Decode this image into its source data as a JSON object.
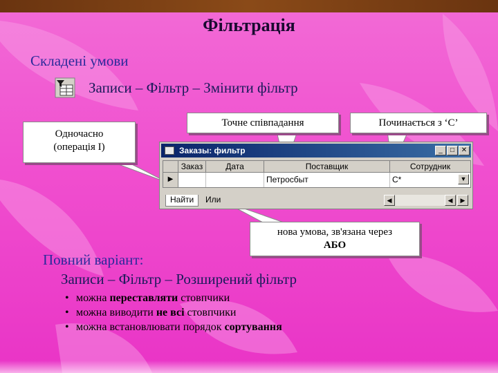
{
  "title": "Фільтрація",
  "subtitle": "Складені умови",
  "menu_path": "Записи – Фільтр – Змінити фільтр",
  "callouts": {
    "simultaneous_line1": "Одночасно",
    "simultaneous_line2": "(операція І)",
    "exact_match": "Точне співпадання",
    "starts_with": "Починається з ‘С’",
    "new_condition_line1": "нова умова, зв'язана через",
    "new_condition_line2": "АБО"
  },
  "window": {
    "title": "Заказы: фильтр",
    "columns": [
      "Заказ",
      "Дата",
      "Поставщик",
      "Сотрудник"
    ],
    "row": {
      "supplier": "Петросбыт",
      "employee": "С*"
    },
    "tabs": {
      "find": "Найти",
      "or": "Или"
    }
  },
  "full_variant": {
    "heading": "Повний варіант:",
    "path": "Записи – Фільтр – Розширений фільтр",
    "bullets": [
      {
        "pre": "можна ",
        "bold": "переставляти",
        "post": " стовпчики"
      },
      {
        "pre": "можна виводити ",
        "bold": "не всі",
        "post": " стовпчики"
      },
      {
        "pre": "можна встановлювати порядок ",
        "bold": "сортування",
        "post": ""
      }
    ]
  },
  "colors": {
    "background": "#f04fcf",
    "title_bar": "#0a246a",
    "heading": "#2a2a9a"
  }
}
